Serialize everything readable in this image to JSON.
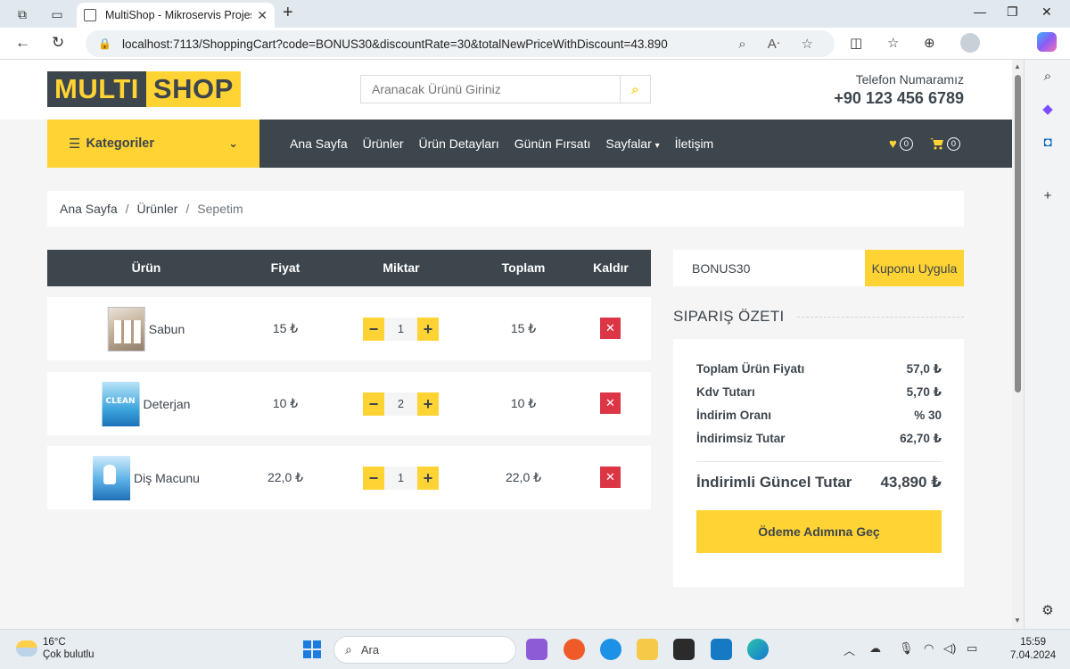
{
  "browser": {
    "tab_title": "MultiShop - Mikroservis Projesi",
    "url": "localhost:7113/ShoppingCart?code=BONUS30&discountRate=30&totalNewPriceWithDiscount=43.890"
  },
  "header": {
    "logo_part1": "MULTI",
    "logo_part2": "SHOP",
    "search_placeholder": "Aranacak Ürünü Giriniz",
    "phone_label": "Telefon Numaramız",
    "phone_number": "+90 123 456 6789"
  },
  "nav": {
    "categories_label": "Kategoriler",
    "links": [
      "Ana Sayfa",
      "Ürünler",
      "Ürün Detayları",
      "Günün Fırsatı",
      "Sayfalar",
      "İletişim"
    ],
    "wishlist_count": "0",
    "cart_count": "0"
  },
  "breadcrumb": {
    "items": [
      "Ana Sayfa",
      "Ürünler",
      "Sepetim"
    ]
  },
  "cart": {
    "headers": [
      "Ürün",
      "Fiyat",
      "Miktar",
      "Toplam",
      "Kaldır"
    ],
    "rows": [
      {
        "name": "Sabun",
        "price": "15 ₺",
        "qty": "1",
        "total": "15 ₺"
      },
      {
        "name": "Deterjan",
        "price": "10 ₺",
        "qty": "2",
        "total": "10 ₺"
      },
      {
        "name": "Diş Macunu",
        "price": "22,0 ₺",
        "qty": "1",
        "total": "22,0 ₺"
      }
    ]
  },
  "coupon": {
    "code": "BONUS30",
    "button": "Kuponu Uygula"
  },
  "summary": {
    "title": "SIPARIŞ ÖZETI",
    "lines": [
      {
        "label": "Toplam Ürün Fiyatı",
        "value": "57,0 ₺"
      },
      {
        "label": "Kdv Tutarı",
        "value": "5,70 ₺"
      },
      {
        "label": "İndirim Oranı",
        "value": "% 30"
      },
      {
        "label": "İndirimsiz Tutar",
        "value": "62,70 ₺"
      }
    ],
    "total_label": "İndirimli Güncel Tutar",
    "total_value": "43,890 ₺",
    "checkout_button": "Ödeme Adımına Geç"
  },
  "taskbar": {
    "temperature": "16°C",
    "weather": "Çok bulutlu",
    "search_placeholder": "Ara",
    "time": "15:59",
    "date": "7.04.2024"
  }
}
